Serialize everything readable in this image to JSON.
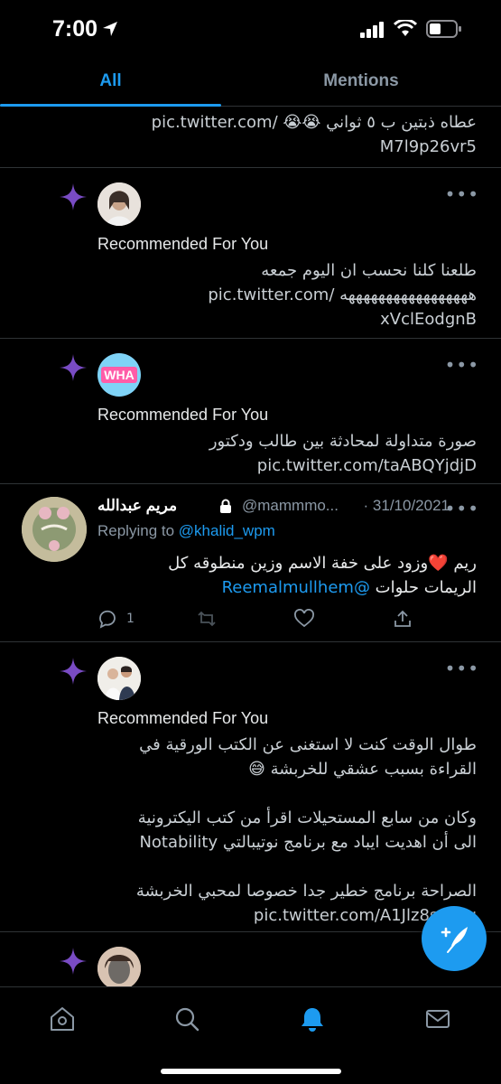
{
  "status": {
    "time": "7:00"
  },
  "tabs": [
    {
      "label": "All",
      "active": true
    },
    {
      "label": "Mentions",
      "active": false
    }
  ],
  "feed": {
    "top_partial": {
      "line1": "عطاه ذبتين ب ٥ ثواني 😭😭 /pic.twitter.com",
      "line2": "M7l9p26vr5"
    },
    "rec1": {
      "label": "Recommended For You",
      "lines": [
        "طلعنا كلنا نحسب ان اليوم جمعه",
        "هههههههههههههههههه /pic.twitter.com",
        "xVclEodgnB"
      ]
    },
    "rec2": {
      "label": "Recommended For You",
      "lines": [
        "صورة متداولة لمحادثة بين طالب ودكتور",
        "pic.twitter.com/taABQYjdjD"
      ],
      "avatar_text": "WHA"
    },
    "reply": {
      "name": "مريم عبدالله",
      "handle": "@mammmo...",
      "date": "· 31/10/2021",
      "replying_prefix": "Replying to",
      "replying_to": "@khalid_wpm",
      "line1": "ريم ❤️وزود على خفة الاسم وزين منطوقه كل",
      "line2_text": "الريمات حلوات",
      "line2_mention": "@Reemalmullhem",
      "reply_count": "1"
    },
    "rec3": {
      "label": "Recommended For You",
      "lines": [
        "طوال الوقت كنت لا استغنى عن الكتب الورقية في",
        "القراءة بسبب عشقي للخربشة 😅",
        "",
        "وكان من سابع المستحيلات اقرأ من كتب اليكترونية",
        "الى أن اهديت ايباد مع برنامج نوتيبالتي Notability",
        "",
        "الصراحة برنامج خطير جدا خصوصا لمحبي الخربشة",
        "pic.twitter.com/A1Jlz8sOWu"
      ]
    }
  },
  "nav": [
    "home-icon",
    "search-icon",
    "notifications-icon",
    "messages-icon"
  ],
  "colors": {
    "accent": "#1d9bf0",
    "sparkle": "#794bc4",
    "heart": "#f91880"
  }
}
